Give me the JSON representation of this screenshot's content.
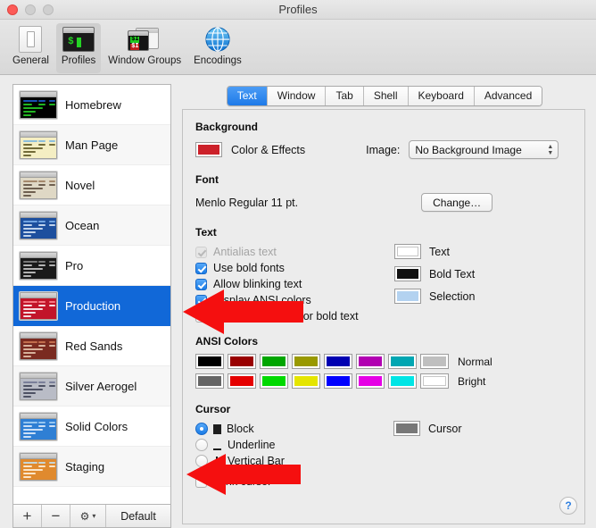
{
  "window": {
    "title": "Profiles",
    "traffic_lights": [
      "close",
      "minimize",
      "maximize"
    ]
  },
  "toolbar": {
    "items": [
      {
        "label": "General",
        "icon": "general-icon",
        "selected": false
      },
      {
        "label": "Profiles",
        "icon": "profiles-icon",
        "selected": true
      },
      {
        "label": "Window Groups",
        "icon": "window-groups-icon",
        "selected": false
      },
      {
        "label": "Encodings",
        "icon": "encodings-globe-icon",
        "selected": false
      }
    ]
  },
  "sidebar": {
    "profiles": [
      {
        "name": "Homebrew",
        "selected": false,
        "bg": "#000000",
        "fg": "#27d527",
        "accent": "#1c5ed2"
      },
      {
        "name": "Man Page",
        "selected": false,
        "bg": "#f4eec3",
        "fg": "#5a5320",
        "accent": "#7ab6e0"
      },
      {
        "name": "Novel",
        "selected": false,
        "bg": "#dfd8c5",
        "fg": "#5b4a3a",
        "accent": "#9b7b5c"
      },
      {
        "name": "Ocean",
        "selected": false,
        "bg": "#1d4f9e",
        "fg": "#dce9f8",
        "accent": "#7fb2ec"
      },
      {
        "name": "Pro",
        "selected": false,
        "bg": "#1a1a1a",
        "fg": "#cfcfcf",
        "accent": "#8a8a8a"
      },
      {
        "name": "Production",
        "selected": true,
        "bg": "#c2152a",
        "fg": "#ffffff",
        "accent": "#ff8b93"
      },
      {
        "name": "Red Sands",
        "selected": false,
        "bg": "#7a2b21",
        "fg": "#e8c9b0",
        "accent": "#d07a55"
      },
      {
        "name": "Silver Aerogel",
        "selected": false,
        "bg": "#b9bcc6",
        "fg": "#3b3f52",
        "accent": "#6e7490"
      },
      {
        "name": "Solid Colors",
        "selected": false,
        "bg": "#2f7fd4",
        "fg": "#e7f1fb",
        "accent": "#a8d2f5"
      },
      {
        "name": "Staging",
        "selected": false,
        "bg": "#e08a2e",
        "fg": "#fff4e3",
        "accent": "#bfe2f5"
      }
    ],
    "footer": {
      "add_label": "+",
      "remove_label": "−",
      "gear_label": "⚙",
      "gear_chevron": "▾",
      "default_label": "Default"
    }
  },
  "detail": {
    "tabs": [
      {
        "label": "Text",
        "active": true
      },
      {
        "label": "Window",
        "active": false
      },
      {
        "label": "Tab",
        "active": false
      },
      {
        "label": "Shell",
        "active": false
      },
      {
        "label": "Keyboard",
        "active": false
      },
      {
        "label": "Advanced",
        "active": false
      }
    ],
    "background": {
      "title": "Background",
      "color_label": "Color & Effects",
      "color_swatch": "#cc2029",
      "image_label": "Image:",
      "image_value": "No Background Image"
    },
    "font": {
      "title": "Font",
      "value": "Menlo Regular 11 pt.",
      "change_label": "Change…"
    },
    "text": {
      "title": "Text",
      "checkboxes": [
        {
          "label": "Antialias text",
          "checked": true,
          "disabled": true
        },
        {
          "label": "Use bold fonts",
          "checked": true,
          "disabled": false
        },
        {
          "label": "Allow blinking text",
          "checked": true,
          "disabled": false
        },
        {
          "label": "Display ANSI colors",
          "checked": true,
          "disabled": false
        },
        {
          "label": "Use bright colors for bold text",
          "checked": false,
          "disabled": false
        }
      ],
      "color_items": [
        {
          "label": "Text",
          "color": "#ffffff",
          "outlined": true
        },
        {
          "label": "Bold Text",
          "color": "#111111",
          "outlined": false
        },
        {
          "label": "Selection",
          "color": "#b3d2f0",
          "outlined": false
        }
      ]
    },
    "ansi": {
      "title": "ANSI Colors",
      "rows": [
        {
          "label": "Normal",
          "colors": [
            "#000000",
            "#990000",
            "#00a600",
            "#999900",
            "#0000b2",
            "#b200b2",
            "#00a6b2",
            "#bfbfbf"
          ]
        },
        {
          "label": "Bright",
          "colors": [
            "#666666",
            "#e50000",
            "#00d900",
            "#e5e500",
            "#0000ff",
            "#e500e5",
            "#00e5e5",
            "#ffffff"
          ]
        }
      ]
    },
    "cursor": {
      "title": "Cursor",
      "options": [
        {
          "label": "Block",
          "selected": true,
          "glyph": "block"
        },
        {
          "label": "Underline",
          "selected": false,
          "glyph": "underline"
        },
        {
          "label": "Vertical Bar",
          "selected": false,
          "glyph": "bar"
        }
      ],
      "blink_label": "Blink cursor",
      "blink_checked": false,
      "cursor_color_label": "Cursor",
      "cursor_color": "#787878"
    },
    "help_label": "?"
  },
  "annotations": {
    "arrows": [
      {
        "name": "arrow-text-options",
        "color": "#f50f0f"
      },
      {
        "name": "arrow-cursor-options",
        "color": "#f50f0f"
      }
    ]
  }
}
